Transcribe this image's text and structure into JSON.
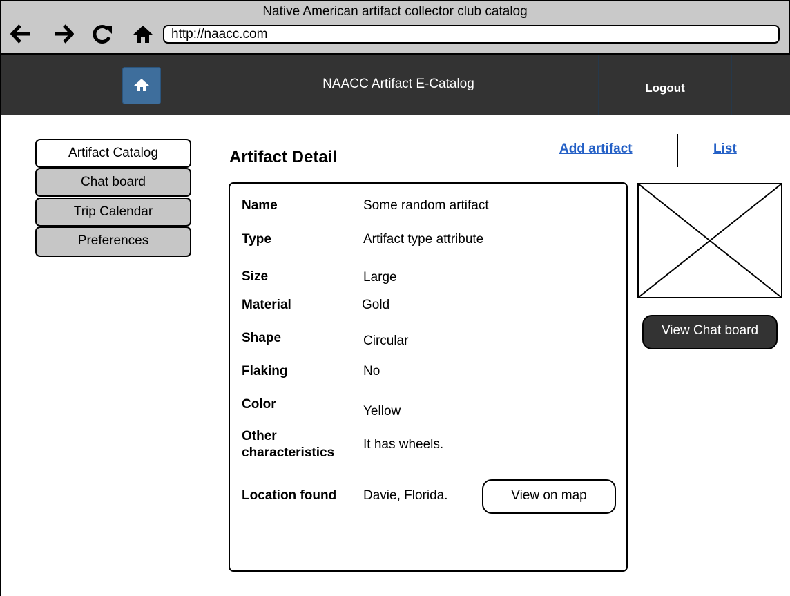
{
  "browser": {
    "window_title": "Native American artifact collector club catalog",
    "url": "http://naacc.com",
    "icons": [
      "back-arrow-icon",
      "forward-arrow-icon",
      "reload-icon",
      "home-icon"
    ]
  },
  "header": {
    "title": "NAACC Artifact E-Catalog",
    "logout_label": "Logout",
    "home_icon": "home-icon",
    "colors": {
      "bar": "#333333",
      "home_button": "#3e6e9c"
    }
  },
  "sidebar": {
    "items": [
      {
        "label": "Artifact Catalog",
        "active": true
      },
      {
        "label": "Chat board",
        "active": false
      },
      {
        "label": "Trip Calendar",
        "active": false
      },
      {
        "label": "Preferences",
        "active": false
      }
    ]
  },
  "main": {
    "heading": "Artifact Detail",
    "links": {
      "add": "Add artifact",
      "list": "List"
    },
    "fields": [
      {
        "label": "Name",
        "value": "Some random artifact"
      },
      {
        "label": "Type",
        "value": "Artifact type attribute"
      },
      {
        "label": "Size",
        "value": "Large"
      },
      {
        "label": "Material",
        "value": "Gold"
      },
      {
        "label": "Shape",
        "value": "Circular"
      },
      {
        "label": "Flaking",
        "value": "No"
      },
      {
        "label": "Color",
        "value": "Yellow"
      },
      {
        "label": "Other characteristics",
        "value": "It has wheels."
      },
      {
        "label": "Location found",
        "value": "Davie, Florida."
      }
    ],
    "view_map_label": "View on map",
    "view_chat_label": "View Chat board",
    "link_color": "#2460c6"
  }
}
